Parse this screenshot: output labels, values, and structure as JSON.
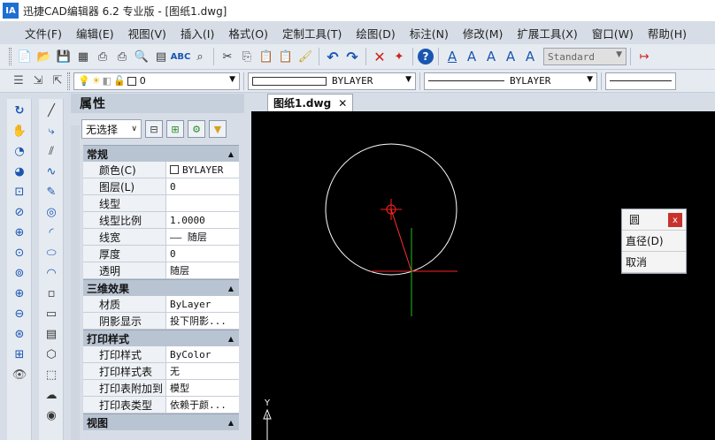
{
  "window": {
    "logo": "IA",
    "title": "迅捷CAD编辑器 6.2 专业版 - [图纸1.dwg]"
  },
  "menu": [
    "文件(F)",
    "编辑(E)",
    "视图(V)",
    "插入(I)",
    "格式(O)",
    "定制工具(T)",
    "绘图(D)",
    "标注(N)",
    "修改(M)",
    "扩展工具(X)",
    "窗口(W)",
    "帮助(H)"
  ],
  "toolbar": {
    "text_style": "Standard"
  },
  "layerbar": {
    "layer": "0",
    "color": "BYLAYER",
    "linetype": "BYLAYER"
  },
  "properties": {
    "title": "属性",
    "selection": "无选择",
    "sections": [
      {
        "name": "常规",
        "rows": [
          {
            "k": "颜色(C)",
            "v": "BYLAYER",
            "swatch": true
          },
          {
            "k": "图层(L)",
            "v": "0"
          },
          {
            "k": "线型",
            "v": ""
          },
          {
            "k": "线型比例",
            "v": "1.0000"
          },
          {
            "k": "线宽",
            "v": "—— 随层"
          },
          {
            "k": "厚度",
            "v": "0"
          },
          {
            "k": "透明",
            "v": "随层"
          }
        ]
      },
      {
        "name": "三维效果",
        "rows": [
          {
            "k": "材质",
            "v": "ByLayer"
          },
          {
            "k": "阴影显示",
            "v": "投下阴影..."
          }
        ]
      },
      {
        "name": "打印样式",
        "rows": [
          {
            "k": "打印样式",
            "v": "ByColor"
          },
          {
            "k": "打印样式表",
            "v": "无"
          },
          {
            "k": "打印表附加到",
            "v": "模型"
          },
          {
            "k": "打印表类型",
            "v": "依赖于颜..."
          }
        ]
      },
      {
        "name": "视图",
        "rows": []
      }
    ]
  },
  "drawing_tab": {
    "name": "图纸1.dwg",
    "close": "✕"
  },
  "canvas": {
    "y_axis_label": "Y"
  },
  "command": {
    "title": "圆",
    "close": "x",
    "options": [
      "直径(D)",
      "取消"
    ]
  }
}
